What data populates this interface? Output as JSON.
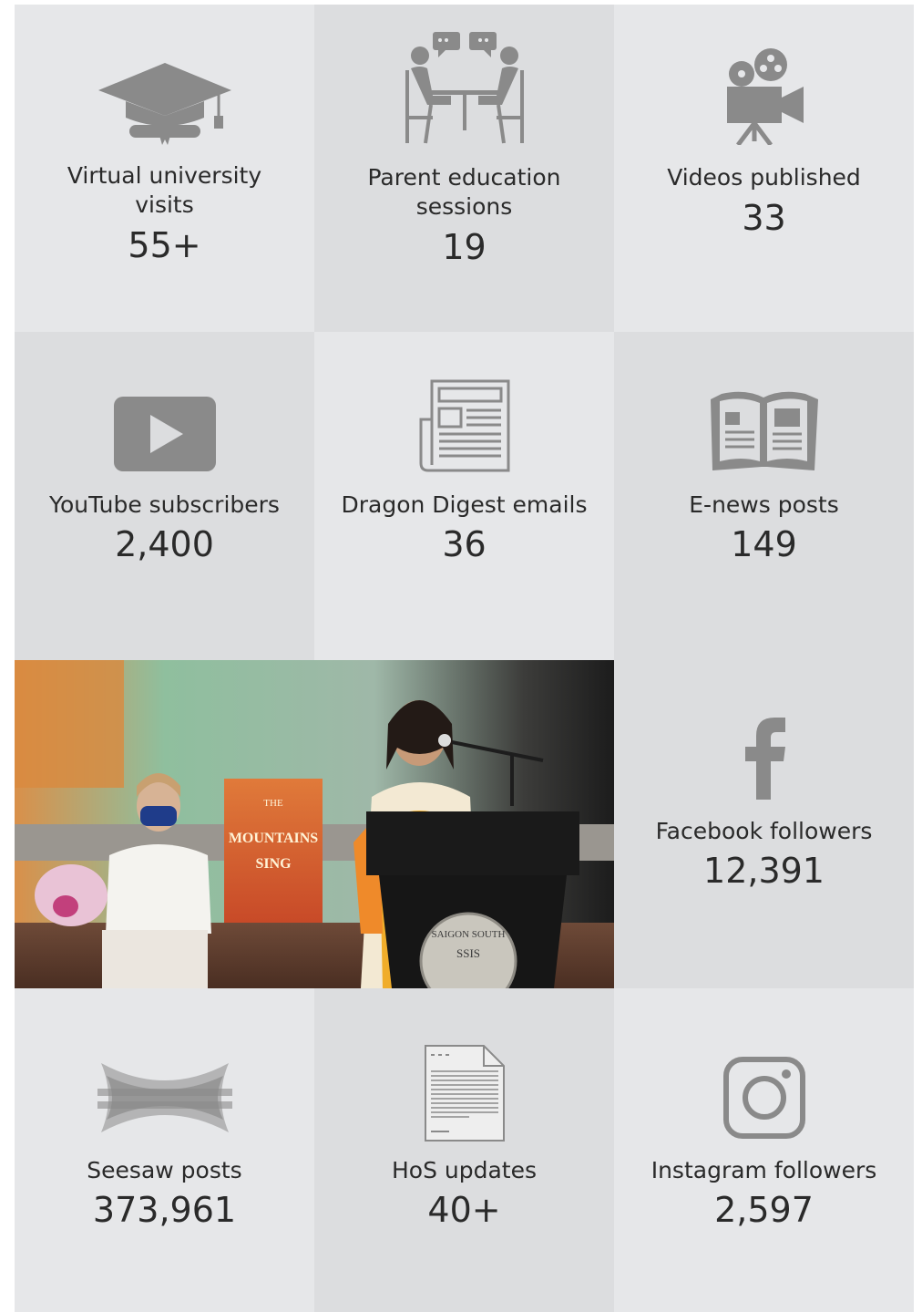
{
  "stats": [
    {
      "label": "Virtual university visits",
      "label_line1": "Virtual university",
      "label_line2": "visits",
      "value": "55+",
      "icon": "graduation-cap-icon"
    },
    {
      "label": "Parent education sessions",
      "label_line1": "Parent education",
      "label_line2": "sessions",
      "value": "19",
      "icon": "meeting-icon"
    },
    {
      "label": "Videos published",
      "value": "33",
      "icon": "film-camera-icon"
    },
    {
      "label": "YouTube subscribers",
      "value": "2,400",
      "icon": "youtube-icon"
    },
    {
      "label": "Dragon Digest emails",
      "value": "36",
      "icon": "newspaper-icon"
    },
    {
      "label": "E-news posts",
      "value": "149",
      "icon": "magazine-icon"
    },
    {
      "label": "Facebook followers",
      "value": "12,391",
      "icon": "facebook-icon"
    },
    {
      "label": "Seesaw posts",
      "value": "373,961",
      "icon": "seesaw-icon"
    },
    {
      "label": "HoS updates",
      "value": "40+",
      "icon": "document-icon"
    },
    {
      "label": "Instagram followers",
      "value": "2,597",
      "icon": "instagram-icon"
    }
  ],
  "photo": {
    "book_title_line1": "THE",
    "book_title_line2": "MOUNTAINS",
    "book_title_line3": "SING",
    "podium_seal_text": "SAIGON SOUTH",
    "podium_seal_abbr": "SSIS"
  },
  "colors": {
    "tile_light": "#e6e7e9",
    "tile_dark": "#dcdddf",
    "icon_gray": "#8a8a8a"
  }
}
